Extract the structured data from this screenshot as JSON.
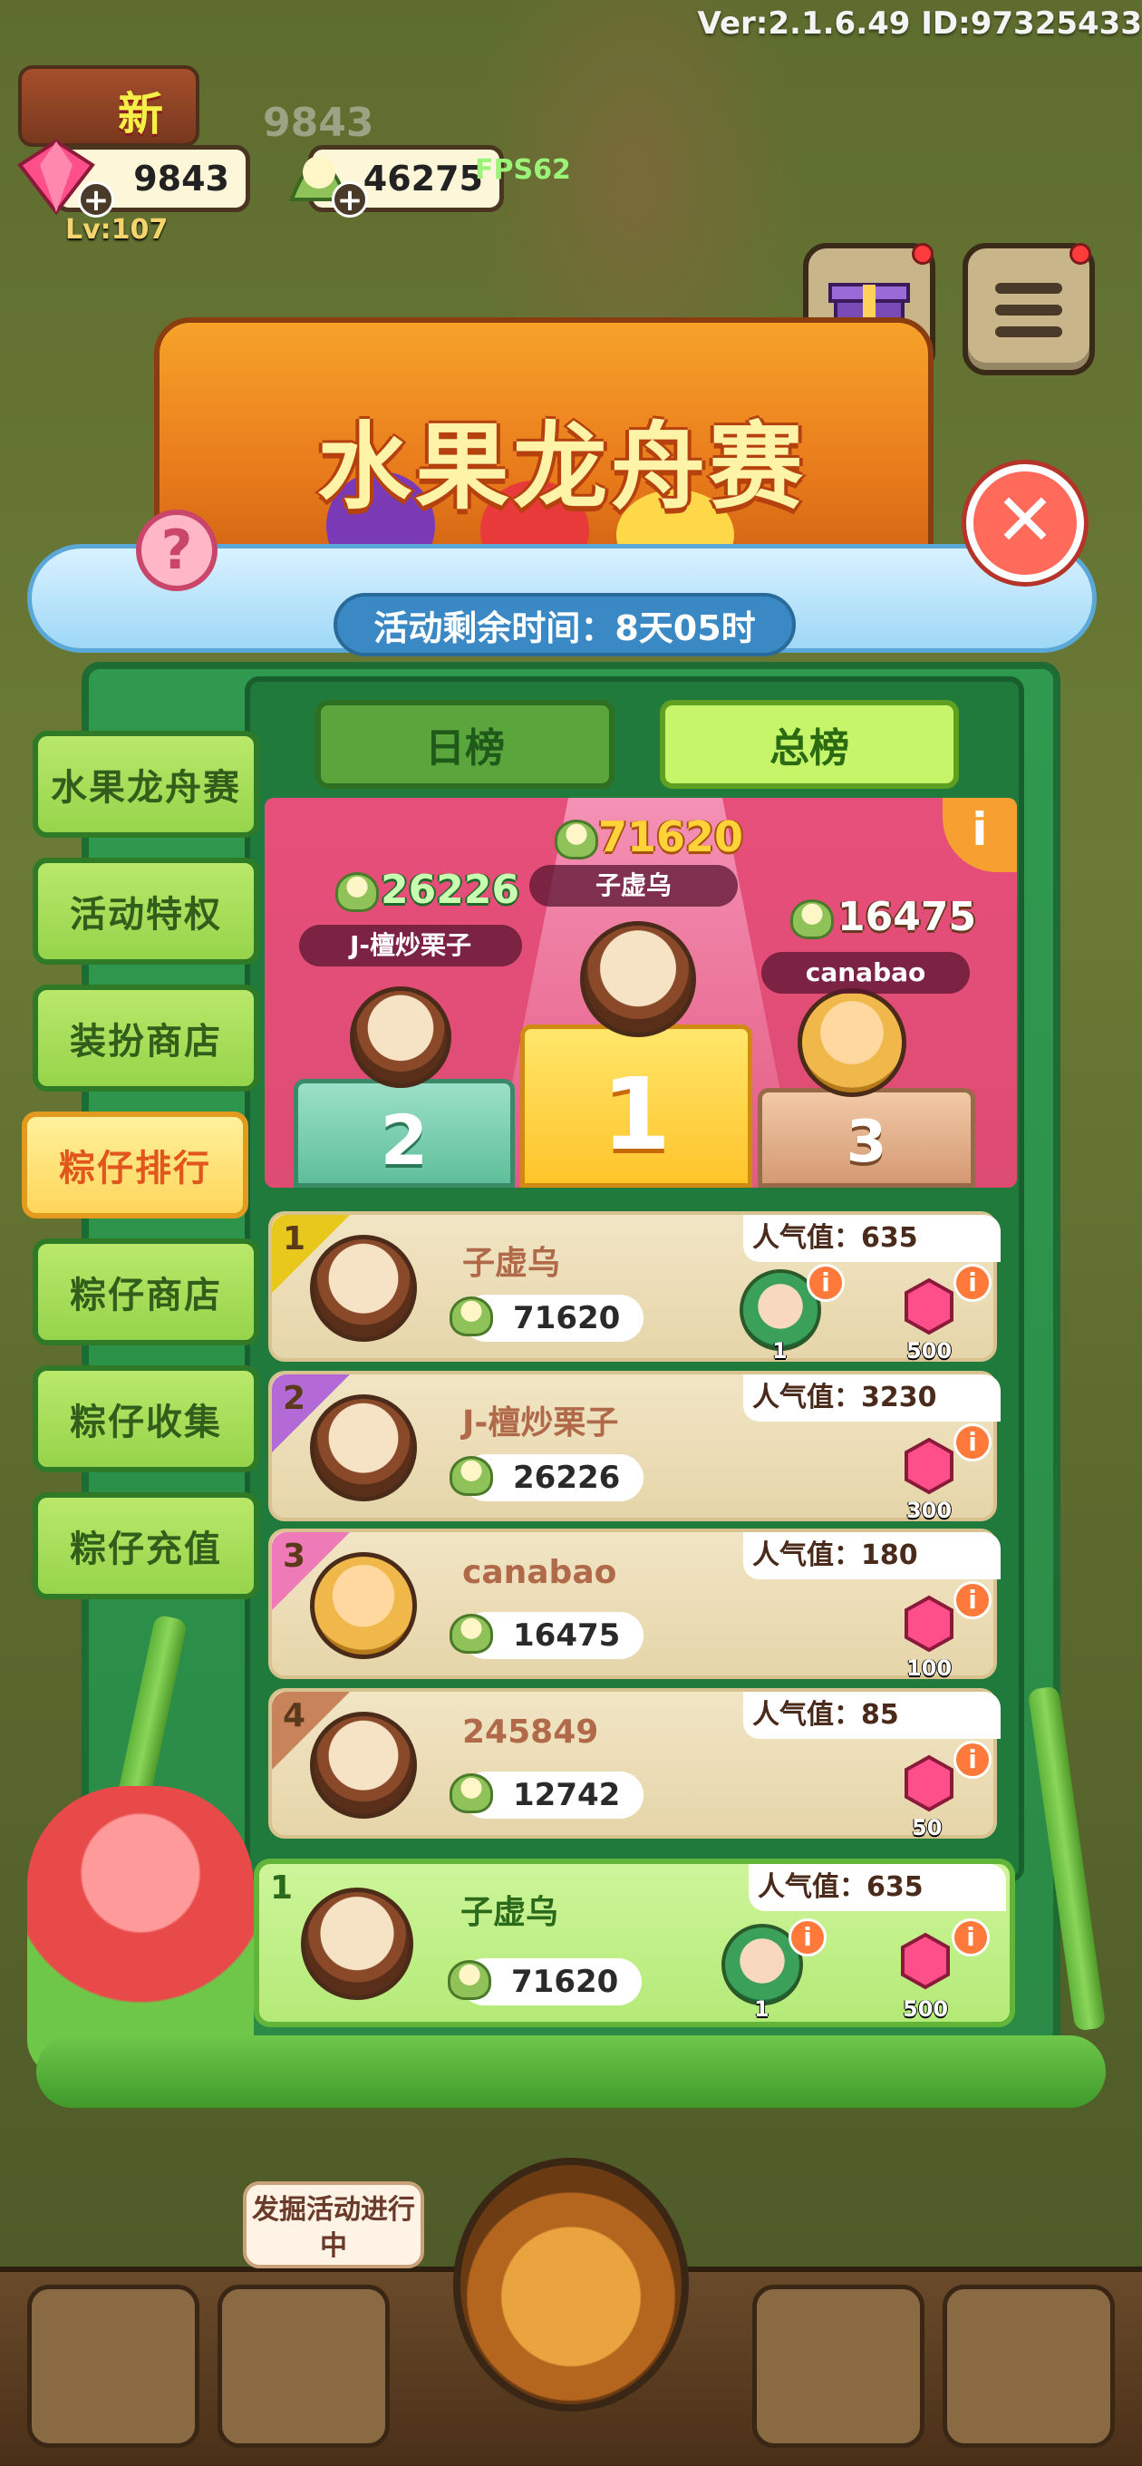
{
  "hud": {
    "version": "Ver:2.1.6.49 ID:97325433",
    "gems": "9843",
    "ghost_gems": "9843",
    "zongzi": "46275",
    "fps": "FPS62",
    "level": "Lv:107",
    "house_badge": "新"
  },
  "event": {
    "title": "水果龙舟赛",
    "timer": "活动剩余时间：8天05时",
    "help": "?",
    "close": "✕"
  },
  "side_menu": [
    {
      "label": "水果龙舟赛",
      "active": false
    },
    {
      "label": "活动特权",
      "active": false
    },
    {
      "label": "装扮商店",
      "active": false
    },
    {
      "label": "粽仔排行",
      "active": true
    },
    {
      "label": "粽仔商店",
      "active": false
    },
    {
      "label": "粽仔收集",
      "active": false
    },
    {
      "label": "粽仔充值",
      "active": false
    }
  ],
  "tabs": {
    "day": "日榜",
    "total": "总榜",
    "selected": "总榜"
  },
  "podium": {
    "info": "i",
    "first": {
      "rank": "1",
      "name": "子虚乌",
      "score": "71620"
    },
    "second": {
      "rank": "2",
      "name": "J-檀炒栗子",
      "score": "26226"
    },
    "third": {
      "rank": "3",
      "name": "canabao",
      "score": "16475"
    }
  },
  "ranking": [
    {
      "rank": "1",
      "name": "子虚乌",
      "score": "71620",
      "popularity": "人气值：635",
      "reward_count": "500",
      "bonus_count": "1",
      "color": "#e8c81a"
    },
    {
      "rank": "2",
      "name": "J-檀炒栗子",
      "score": "26226",
      "popularity": "人气值：3230",
      "reward_count": "300",
      "color": "#b46ad6"
    },
    {
      "rank": "3",
      "name": "canabao",
      "score": "16475",
      "popularity": "人气值：180",
      "reward_count": "100",
      "color": "#ef7ab8"
    },
    {
      "rank": "4",
      "name": "245849",
      "score": "12742",
      "popularity": "人气值：85",
      "reward_count": "50",
      "color": "#c9835a"
    }
  ],
  "my_rank": {
    "rank": "1",
    "name": "子虚乌",
    "score": "71620",
    "popularity": "人气值：635",
    "reward_count": "500",
    "bonus_count": "1"
  },
  "bottom": {
    "dig_status": "发掘活动进行中"
  },
  "colors": {
    "panel_green": "#2a8a46",
    "podium_pink": "#e64f7a",
    "active_tab": "#c7f56a"
  }
}
